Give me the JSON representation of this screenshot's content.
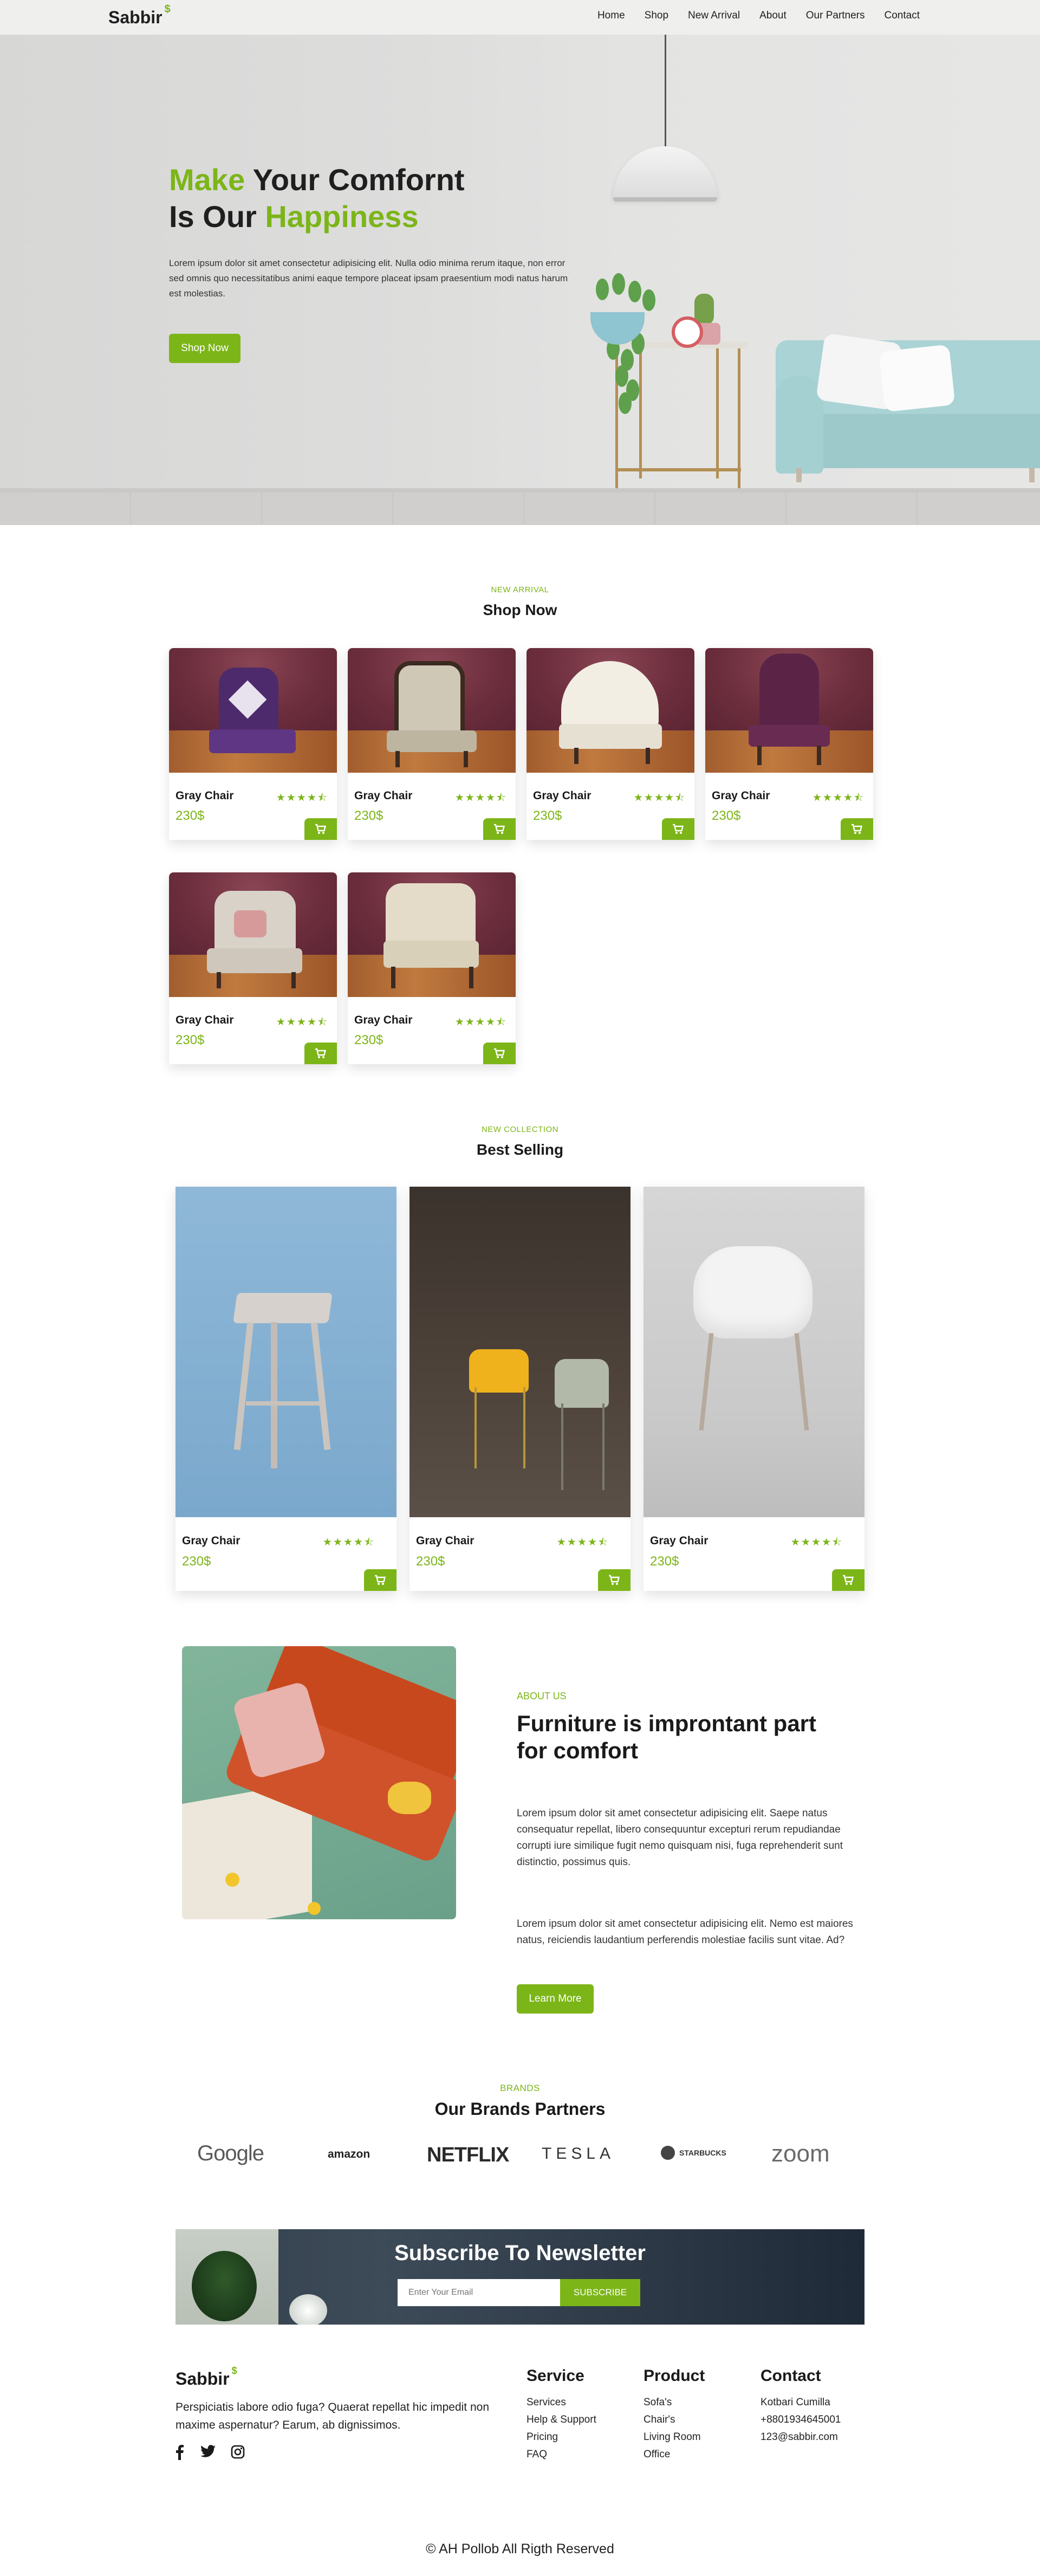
{
  "nav": {
    "logo": "Sabbir",
    "logo_mark": "$",
    "links": [
      "Home",
      "Shop",
      "New Arrival",
      "About",
      "Our Partners",
      "Contact"
    ]
  },
  "hero": {
    "title_line1_accent": "Make",
    "title_line1_rest": " Your Comfornt",
    "title_line2_rest": "Is Our ",
    "title_line2_accent": "Happiness",
    "text": "Lorem ipsum dolor sit amet consectetur adipisicing elit. Nulla odio minima rerum itaque, non error sed omnis quo necessitatibus animi eaque tempore placeat ipsam praesentium modi natus harum est molestias.",
    "button": "Shop Now"
  },
  "shop": {
    "eyebrow": "NEW ARRIVAL",
    "title": "Shop Now",
    "products": [
      {
        "name": "Gray Chair",
        "price": "230$",
        "rating": 4.5
      },
      {
        "name": "Gray Chair",
        "price": "230$",
        "rating": 4.5
      },
      {
        "name": "Gray Chair",
        "price": "230$",
        "rating": 4.5
      },
      {
        "name": "Gray Chair",
        "price": "230$",
        "rating": 4.5
      },
      {
        "name": "Gray Chair",
        "price": "230$",
        "rating": 4.5
      },
      {
        "name": "Gray Chair",
        "price": "230$",
        "rating": 4.5
      }
    ]
  },
  "best": {
    "eyebrow": "NEW COLLECTION",
    "title": "Best Selling",
    "products": [
      {
        "name": "Gray Chair",
        "price": "230$",
        "rating": 4.5
      },
      {
        "name": "Gray Chair",
        "price": "230$",
        "rating": 4.5
      },
      {
        "name": "Gray Chair",
        "price": "230$",
        "rating": 4.5
      }
    ]
  },
  "about": {
    "eyebrow": "ABOUT US",
    "title": "Furniture is improntant part for comfort",
    "p1": "Lorem ipsum dolor sit amet consectetur adipisicing elit. Saepe natus consequatur repellat, libero consequuntur excepturi rerum repudiandae corrupti iure similique fugit nemo quisquam nisi, fuga reprehenderit sunt distinctio, possimus quis.",
    "p2": "Lorem ipsum dolor sit amet consectetur adipisicing elit. Nemo est maiores natus, reiciendis laudantium perferendis molestiae facilis sunt vitae. Ad?",
    "button": "Learn More"
  },
  "brands": {
    "eyebrow": "BRANDS",
    "title": "Our Brands Partners",
    "logos": [
      "Google",
      "amazon",
      "NETFLIX",
      "TESLA",
      "STARBUCKS",
      "zoom"
    ]
  },
  "newsletter": {
    "title": "Subscribe To Newsletter",
    "placeholder": "Enter Your Email",
    "button": "SUBSCRIBE"
  },
  "footer": {
    "logo": "Sabbir",
    "logo_mark": "$",
    "description": "Perspiciatis labore odio fuga? Quaerat repellat hic impedit non maxime aspernatur? Earum, ab dignissimos.",
    "social_icons": [
      "facebook-icon",
      "twitter-icon",
      "instagram-icon"
    ],
    "columns": [
      {
        "title": "Service",
        "links": [
          "Services",
          "Help & Support",
          "Pricing",
          "FAQ"
        ]
      },
      {
        "title": "Product",
        "links": [
          "Sofa's",
          "Chair's",
          "Living Room",
          "Office"
        ]
      },
      {
        "title": "Contact",
        "links": [
          "Kotbari Cumilla",
          "+8801934645001",
          "123@sabbir.com"
        ]
      }
    ],
    "copyright": "© AH Pollob All Rigth Reserved"
  },
  "colors": {
    "accent": "#7cb518",
    "nav_bg": "#efefee",
    "text": "#1a1a1a"
  }
}
